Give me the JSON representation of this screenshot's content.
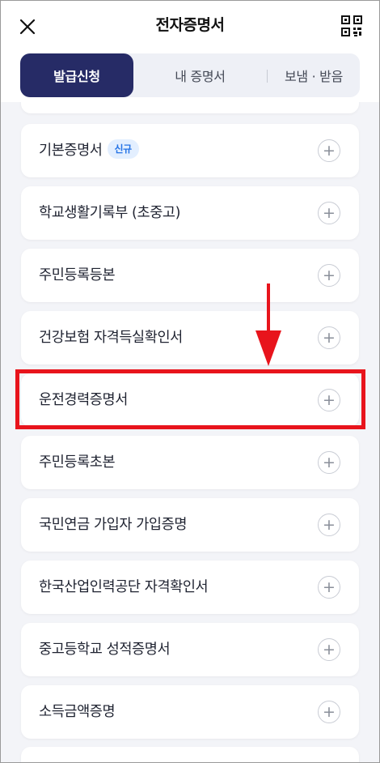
{
  "header": {
    "title": "전자증명서",
    "close_icon": "close-icon",
    "qr_icon": "qr-code-icon"
  },
  "tabs": [
    {
      "label": "발급신청",
      "active": true
    },
    {
      "label": "내 증명서",
      "active": false
    },
    {
      "label": "보냄 · 받음",
      "active": false
    }
  ],
  "items": [
    {
      "label": ""
    },
    {
      "label": "기본증명서",
      "badge": "신규"
    },
    {
      "label": "학교생활기록부 (초중고)"
    },
    {
      "label": "주민등록등본"
    },
    {
      "label": "건강보험 자격득실확인서"
    },
    {
      "label": "운전경력증명서",
      "highlighted": true
    },
    {
      "label": "주민등록초본"
    },
    {
      "label": "국민연금 가입자 가입증명"
    },
    {
      "label": "한국산업인력공단 자격확인서"
    },
    {
      "label": "중고등학교 성적증명서"
    },
    {
      "label": "소득금액증명"
    },
    {
      "label": ""
    }
  ],
  "plus_symbol": "+",
  "colors": {
    "active_tab": "#262b66",
    "highlight": "#e8141c",
    "badge_bg": "#e3efff",
    "badge_text": "#2473e6",
    "background": "#f3f4f8"
  }
}
